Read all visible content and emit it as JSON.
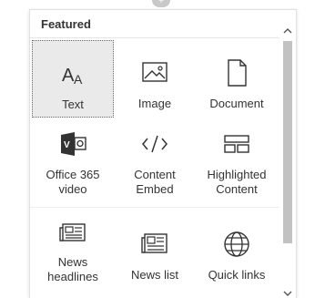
{
  "panel": {
    "section_title": "Featured"
  },
  "tiles": [
    {
      "label": "Text",
      "icon": "text-icon",
      "selected": true
    },
    {
      "label": "Image",
      "icon": "image-icon"
    },
    {
      "label": "Document",
      "icon": "document-icon"
    },
    {
      "label": "Office 365 video",
      "icon": "office-365-video-icon"
    },
    {
      "label": "Content Embed",
      "icon": "code-embed-icon"
    },
    {
      "label": "Highlighted Content",
      "icon": "highlighted-content-icon"
    },
    {
      "label": "News headlines",
      "icon": "news-headlines-icon"
    },
    {
      "label": "News list",
      "icon": "news-list-icon"
    },
    {
      "label": "Quick links",
      "icon": "globe-icon"
    }
  ],
  "icon_glyphs": {
    "text_glyph": "A",
    "text_glyph_small": "A",
    "video_badge": "V"
  },
  "colors": {
    "selected_bg": "#eaeaea",
    "scroll_thumb": "#c2c2c2",
    "text": "#333333"
  }
}
